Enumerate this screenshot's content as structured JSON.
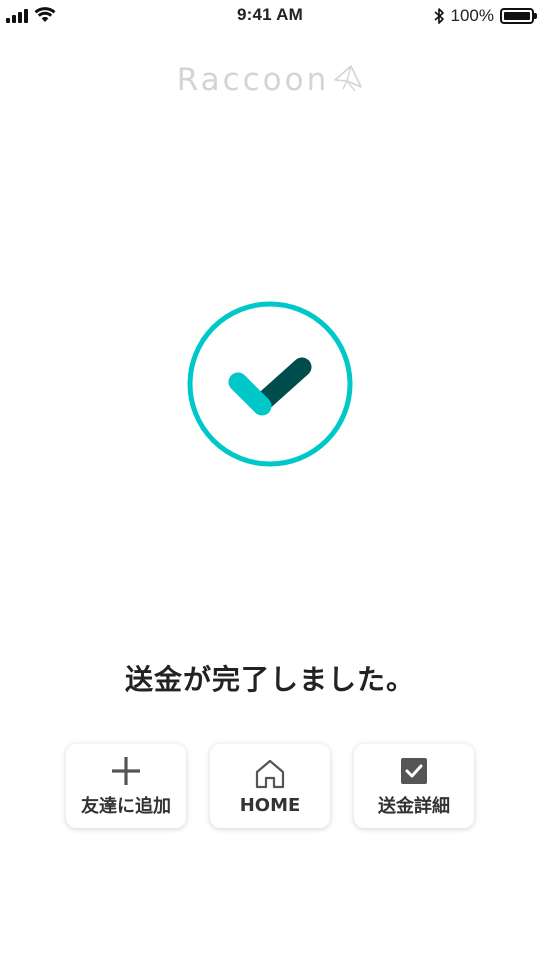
{
  "status_bar": {
    "time": "9:41 AM",
    "battery_percent": "100%",
    "battery_level": 1.0,
    "icons": [
      "signal-icon",
      "wifi-icon",
      "bluetooth-icon",
      "battery-icon"
    ]
  },
  "logo": {
    "text": "Raccoon",
    "color": "#d4d4d4"
  },
  "success": {
    "icon": "check-circle-icon",
    "ring_color": "#00c8c8",
    "check_colors": [
      "#00c8c8",
      "#004d4d"
    ]
  },
  "message": "送金が完了しました。",
  "actions": [
    {
      "label": "友達に追加",
      "icon": "plus-icon"
    },
    {
      "label": "HOME",
      "icon": "home-icon"
    },
    {
      "label": "送金詳細",
      "icon": "checkbox-icon"
    }
  ]
}
